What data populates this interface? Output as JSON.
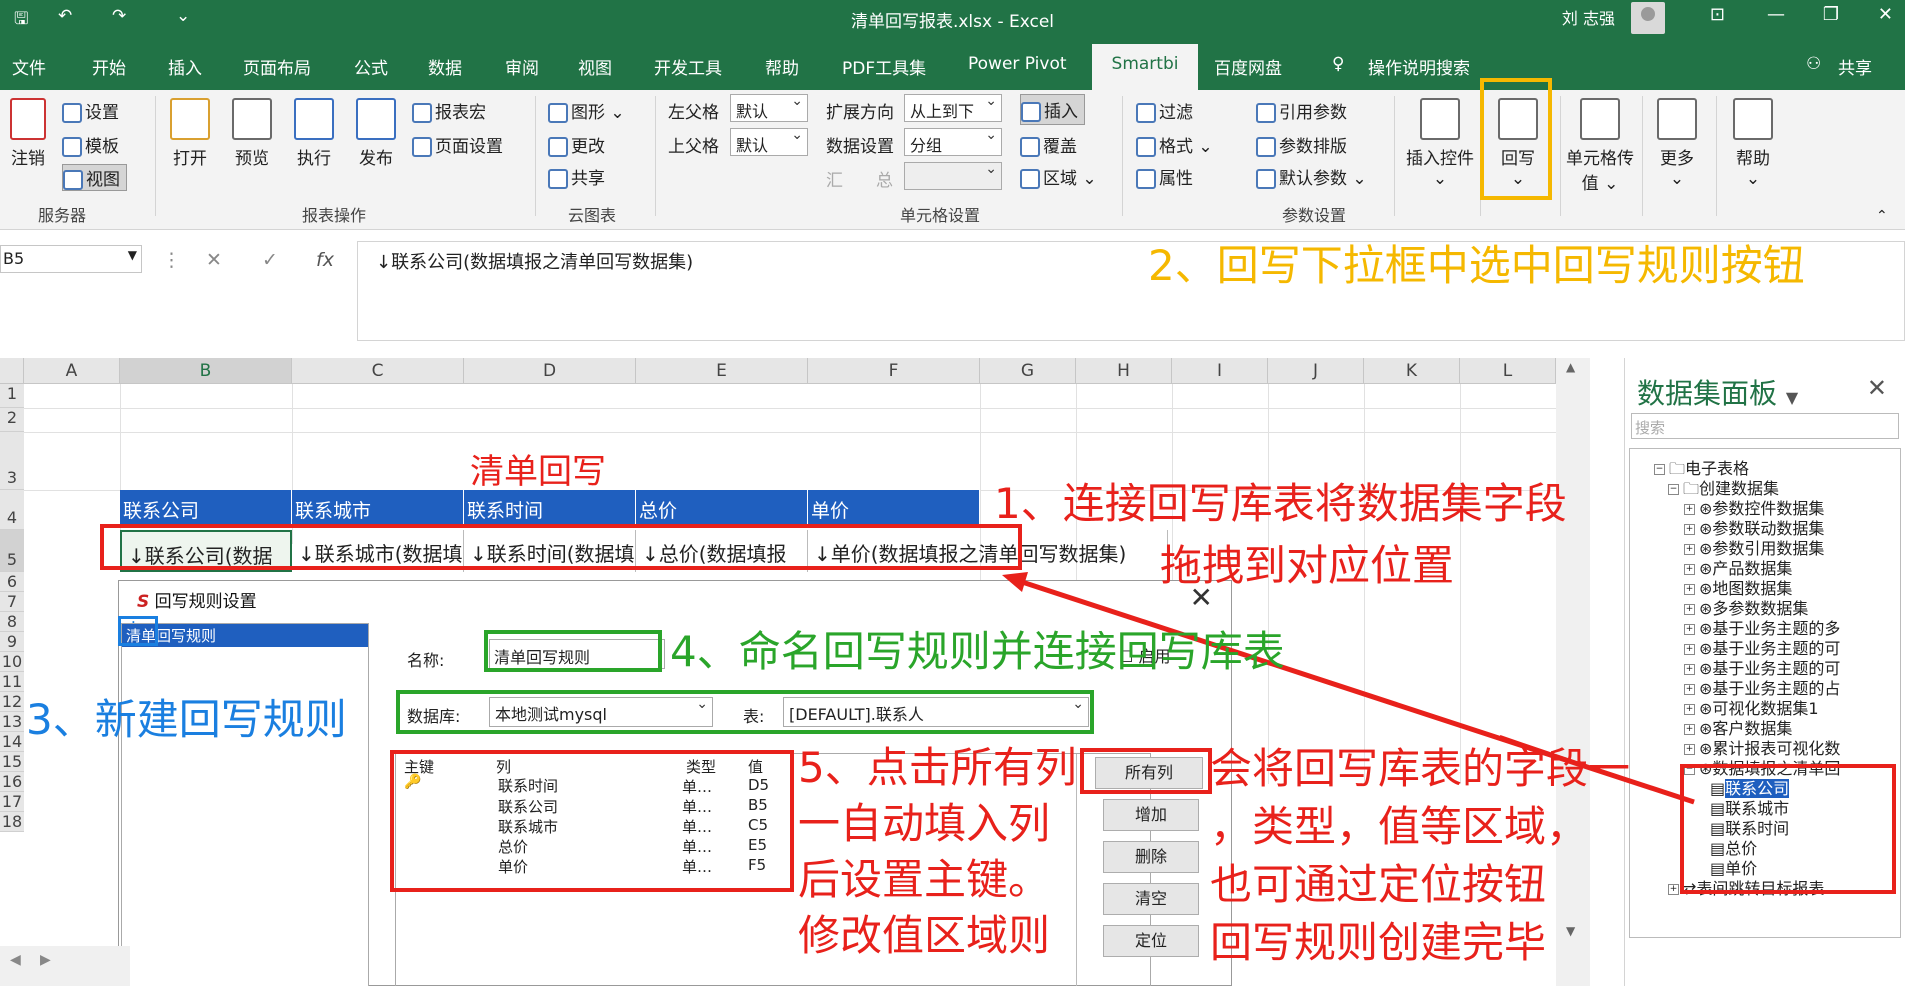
{
  "title": "清单回写报表.xlsx  -  Excel",
  "user": "刘 志强",
  "menu": [
    "文件",
    "开始",
    "插入",
    "页面布局",
    "公式",
    "数据",
    "审阅",
    "视图",
    "开发工具",
    "帮助",
    "PDF工具集",
    "Power Pivot",
    "Smartbi",
    "百度网盘",
    "操作说明搜索",
    "共享"
  ],
  "ribbon": {
    "server": {
      "login": "注销",
      "settings": "设置",
      "template": "模板",
      "view": "视图",
      "label": "服务器"
    },
    "report": {
      "open": "打开",
      "preview": "预览",
      "execute": "执行",
      "publish": "发布",
      "macro": "报表宏",
      "page_setup": "页面设置",
      "label": "报表操作"
    },
    "cloud": {
      "chart": "图形",
      "change": "更改",
      "share": "共享",
      "label": "云图表"
    },
    "cell": {
      "left_parent": "左父格",
      "top_parent": "上父格",
      "default": "默认",
      "expand": "扩展方向",
      "expand_val": "从上到下",
      "data_set": "数据设置",
      "data_val": "分组",
      "sum1": "汇",
      "sum2": "总",
      "insert": "插入",
      "cover": "覆盖",
      "area": "区域",
      "label": "单元格设置"
    },
    "param": {
      "filter": "过滤",
      "format": "格式",
      "attr": "属性",
      "ref": "引用参数",
      "arrange": "参数排版",
      "default": "默认参数",
      "label": "参数设置"
    },
    "insert_ctrl": "插入控件",
    "writeback": "回写",
    "cell_pass": "单元格传值",
    "more": "更多",
    "help": "帮助"
  },
  "namebox": "B5",
  "formula": "↓联系公司(数据填报之清单回写数据集)",
  "columns": [
    "A",
    "B",
    "C",
    "D",
    "E",
    "F",
    "G",
    "H",
    "I",
    "J",
    "K",
    "L"
  ],
  "rows": [
    "1",
    "2",
    "3",
    "4",
    "5",
    "6",
    "7",
    "8",
    "9",
    "10",
    "11",
    "12",
    "13",
    "14",
    "15",
    "16",
    "17",
    "18"
  ],
  "sheet": {
    "title": "清单回写",
    "headers": [
      "联系公司",
      "联系城市",
      "联系时间",
      "总价",
      "单价"
    ],
    "cells": [
      "↓联系公司(数据",
      "↓联系城市(数据填",
      "↓联系时间(数据填",
      "↓总价(数据填报",
      "↓单价(数据填报之清单回写数据集)"
    ]
  },
  "panel": {
    "title": "数据集面板",
    "search": "搜索",
    "tree": [
      "电子表格",
      "创建数据集",
      "参数控件数据集",
      "参数联动数据集",
      "参数引用数据集",
      "产品数据集",
      "地图数据集",
      "多参数数据集",
      "基于业务主题的多",
      "基于业务主题的可",
      "基于业务主题的可",
      "基于业务主题的占",
      "可视化数据集1",
      "客户数据集",
      "累计报表可视化数",
      "数据填报之清单回",
      "联系公司",
      "联系城市",
      "联系时间",
      "总价",
      "单价",
      "表间跳转目标报表"
    ]
  },
  "dialog": {
    "title": "回写规则设置",
    "rule_name": "清单回写规则",
    "name_label": "名称:",
    "db_label": "数据库:",
    "db_value": "本地测试mysql",
    "table_label": "表:",
    "table_value": "[DEFAULT].联系人",
    "enable": "启用",
    "col_headers": [
      "主键",
      "列",
      "类型",
      "值"
    ],
    "rows": [
      [
        "联系时间",
        "单…",
        "D5"
      ],
      [
        "联系公司",
        "单…",
        "B5"
      ],
      [
        "联系城市",
        "单…",
        "C5"
      ],
      [
        "总价",
        "单…",
        "E5"
      ],
      [
        "单价",
        "单…",
        "F5"
      ]
    ],
    "buttons": [
      "所有列",
      "增加",
      "删除",
      "清空",
      "定位"
    ]
  },
  "annotations": {
    "a1": "1、连接回写库表将数据集字段",
    "a1b": "拖拽到对应位置",
    "a2": "2、回写下拉框中选中回写规则按钮",
    "a3": "3、新建回写规则",
    "a4": "4、命名回写规则并连接回写库表",
    "a5": [
      "5、点击所有列",
      "一自动填入列",
      "后设置主键。",
      "修改值区域则"
    ],
    "a6": [
      "会将回写库表的字段一",
      "，类型，值等区域，",
      "也可通过定位按钮",
      "回写规则创建完毕"
    ]
  },
  "colors": {
    "excel_green": "#217346",
    "header_blue": "#1f5fbf",
    "red": "#e8211b",
    "orange": "#f5b800",
    "green": "#2aa52a",
    "blue": "#1a7fe0"
  }
}
